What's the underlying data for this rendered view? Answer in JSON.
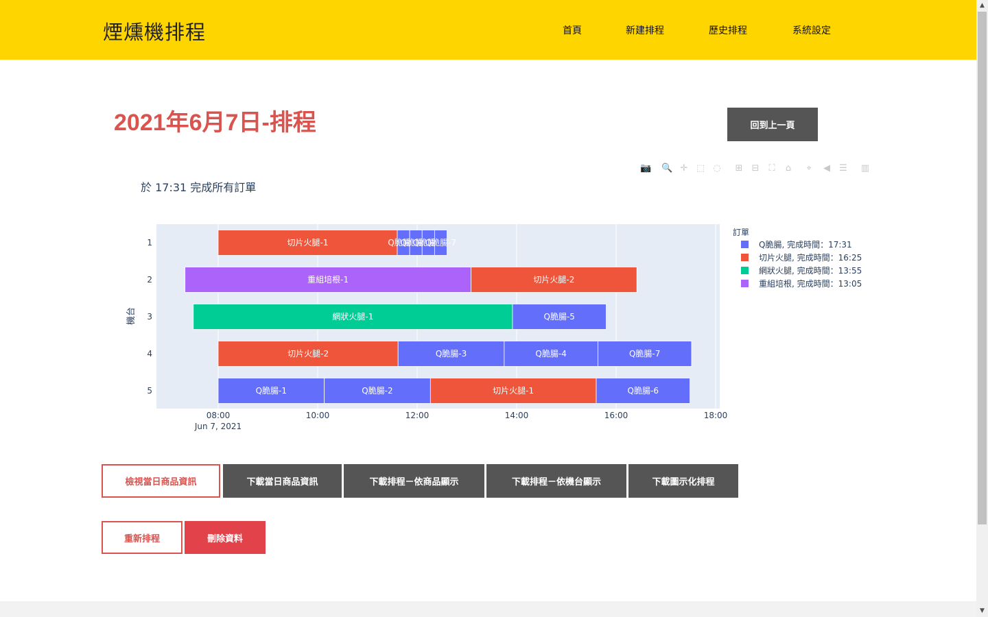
{
  "navbar": {
    "brand": "煙燻機排程",
    "links": [
      "首頁",
      "新建排程",
      "歷史排程",
      "系統設定"
    ]
  },
  "page": {
    "title": "2021年6月7日-排程",
    "back_button": "回到上一頁"
  },
  "chart_caption": "於 17:31 完成所有訂單",
  "modebar_icons": [
    "camera-icon",
    "zoom-icon",
    "pan-icon",
    "box-select-icon",
    "lasso-icon",
    "zoom-in-icon",
    "zoom-out-icon",
    "autoscale-icon",
    "reset-axes-icon",
    "spike-lines-icon",
    "hover-closest-icon",
    "hover-compare-icon",
    "plotly-logo-icon"
  ],
  "chart_data": {
    "type": "gantt",
    "ylabel": "機台",
    "x_date_label": "Jun 7, 2021",
    "x_ticks": [
      "08:00",
      "10:00",
      "12:00",
      "14:00",
      "16:00",
      "18:00"
    ],
    "x_range": [
      "06:45",
      "18:05"
    ],
    "y_categories": [
      "1",
      "2",
      "3",
      "4",
      "5"
    ],
    "legend_title": "訂單",
    "legend": [
      {
        "label": "Q脆腸, 完成時間：17:31",
        "color": "#636EFA"
      },
      {
        "label": "切片火腿, 完成時間：16:25",
        "color": "#EF553B"
      },
      {
        "label": "網狀火腿, 完成時間：13:55",
        "color": "#00CC96"
      },
      {
        "label": "重組培根, 完成時間：13:05",
        "color": "#AB63FA"
      }
    ],
    "tasks": [
      {
        "machine": "1",
        "label": "切片火腿-1",
        "start": "08:00",
        "end": "11:36",
        "color": "#EF553B"
      },
      {
        "machine": "1",
        "label": "Q脆腸-5",
        "start": "11:36",
        "end": "11:51",
        "color": "#636EFA"
      },
      {
        "machine": "1",
        "label": "Q脆腸-6",
        "start": "11:51",
        "end": "12:06",
        "color": "#636EFA"
      },
      {
        "machine": "1",
        "label": "Q脆腸-8",
        "start": "12:06",
        "end": "12:21",
        "color": "#636EFA"
      },
      {
        "machine": "1",
        "label": "Q脆腸-7",
        "start": "12:21",
        "end": "12:36",
        "color": "#636EFA"
      },
      {
        "machine": "2",
        "label": "重組培根-1",
        "start": "07:20",
        "end": "13:05",
        "color": "#AB63FA"
      },
      {
        "machine": "2",
        "label": "切片火腿-2",
        "start": "13:05",
        "end": "16:25",
        "color": "#EF553B"
      },
      {
        "machine": "3",
        "label": "網狀火腿-1",
        "start": "07:30",
        "end": "13:55",
        "color": "#00CC96"
      },
      {
        "machine": "3",
        "label": "Q脆腸-5",
        "start": "13:55",
        "end": "15:48",
        "color": "#636EFA"
      },
      {
        "machine": "4",
        "label": "切片火腿-2",
        "start": "08:00",
        "end": "11:37",
        "color": "#EF553B"
      },
      {
        "machine": "4",
        "label": "Q脆腸-3",
        "start": "11:37",
        "end": "13:45",
        "color": "#636EFA"
      },
      {
        "machine": "4",
        "label": "Q脆腸-4",
        "start": "13:45",
        "end": "15:38",
        "color": "#636EFA"
      },
      {
        "machine": "4",
        "label": "Q脆腸-7",
        "start": "15:38",
        "end": "17:31",
        "color": "#636EFA"
      },
      {
        "machine": "5",
        "label": "Q脆腸-1",
        "start": "08:00",
        "end": "10:08",
        "color": "#636EFA"
      },
      {
        "machine": "5",
        "label": "Q脆腸-2",
        "start": "10:08",
        "end": "12:16",
        "color": "#636EFA"
      },
      {
        "machine": "5",
        "label": "切片火腿-1",
        "start": "12:16",
        "end": "15:36",
        "color": "#EF553B"
      },
      {
        "machine": "5",
        "label": "Q脆腸-6",
        "start": "15:36",
        "end": "17:29",
        "color": "#636EFA"
      }
    ]
  },
  "actions": {
    "view_products": "檢視當日商品資訊",
    "download_products": "下載當日商品資訊",
    "download_by_product": "下載排程－依商品顯示",
    "download_by_machine": "下載排程－依機台顯示",
    "download_chart": "下載圖示化排程",
    "reschedule": "重新排程",
    "delete": "刪除資料"
  }
}
